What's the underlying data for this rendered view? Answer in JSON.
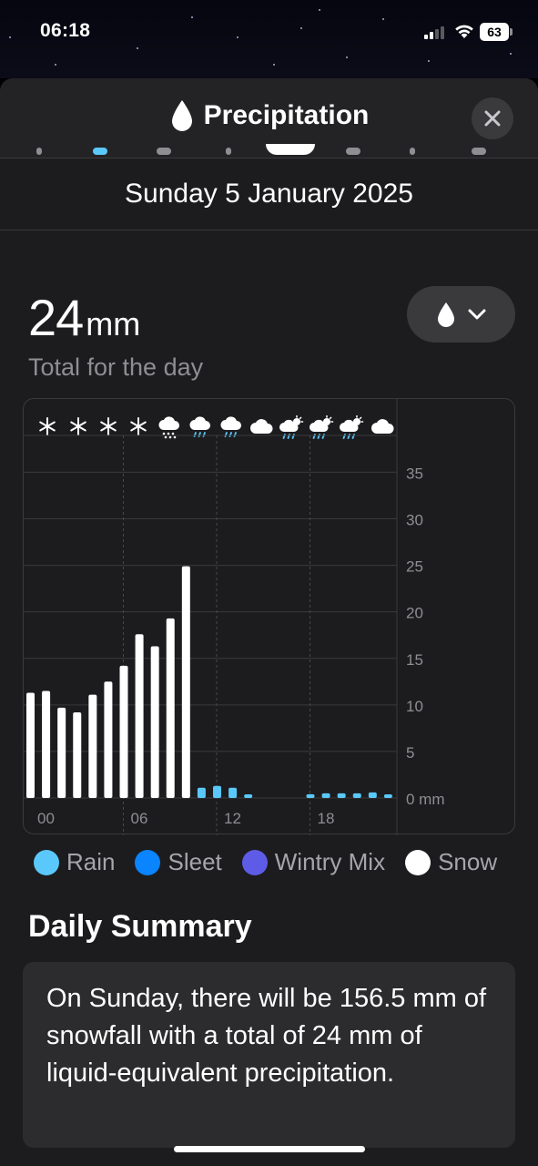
{
  "status_bar": {
    "time": "06:18",
    "battery": "63"
  },
  "header": {
    "title": "Precipitation",
    "title_icon": "raindrop-icon",
    "close_icon": "close-icon"
  },
  "date": "Sunday 5 January 2025",
  "total": {
    "value": "24",
    "unit": "mm",
    "label": "Total for the day"
  },
  "metric_selector": {
    "icon": "raindrop-icon",
    "chevron": "chevron-down-icon"
  },
  "weather_icons": [
    "snowflake",
    "snowflake",
    "snowflake",
    "snowflake",
    "snow-cloud",
    "rain-cloud",
    "rain-cloud",
    "cloud",
    "sun-rain-cloud",
    "sun-rain-cloud",
    "sun-rain-cloud",
    "cloud"
  ],
  "chart_data": {
    "type": "bar",
    "x_tick_labels": [
      "00",
      "06",
      "12",
      "18"
    ],
    "y_tick_labels": [
      "35",
      "30",
      "25",
      "20",
      "15",
      "10",
      "5",
      "0 mm"
    ],
    "ylim": [
      0,
      37
    ],
    "hours": [
      0,
      1,
      2,
      3,
      4,
      5,
      6,
      7,
      8,
      9,
      10,
      11,
      12,
      13,
      14,
      15,
      16,
      17,
      18,
      19,
      20,
      21,
      22,
      23
    ],
    "values": [
      11.3,
      11.5,
      9.7,
      9.2,
      11.1,
      12.5,
      14.2,
      17.6,
      16.3,
      19.3,
      24.9,
      1.1,
      1.3,
      1.1,
      0.3,
      0,
      0,
      0,
      0.4,
      0.5,
      0.5,
      0.5,
      0.6,
      0.3
    ],
    "types": [
      "snow",
      "snow",
      "snow",
      "snow",
      "snow",
      "snow",
      "snow",
      "snow",
      "snow",
      "snow",
      "snow",
      "rain",
      "rain",
      "rain",
      "rain",
      "rain",
      "rain",
      "rain",
      "rain",
      "rain",
      "rain",
      "rain",
      "rain",
      "rain"
    ],
    "gridlines": true,
    "colors": {
      "rain": "#5ac8fa",
      "sleet": "#0a84ff",
      "wintry_mix": "#5e5ce6",
      "snow": "#ffffff"
    }
  },
  "legend": [
    {
      "label": "Rain",
      "color": "#5ac8fa"
    },
    {
      "label": "Sleet",
      "color": "#0a84ff"
    },
    {
      "label": "Wintry Mix",
      "color": "#5e5ce6"
    },
    {
      "label": "Snow",
      "color": "#ffffff"
    }
  ],
  "summary": {
    "title": "Daily Summary",
    "text": "On Sunday, there will be 156.5 mm of snowfall with a total of 24 mm of liquid-equivalent precipitation."
  }
}
